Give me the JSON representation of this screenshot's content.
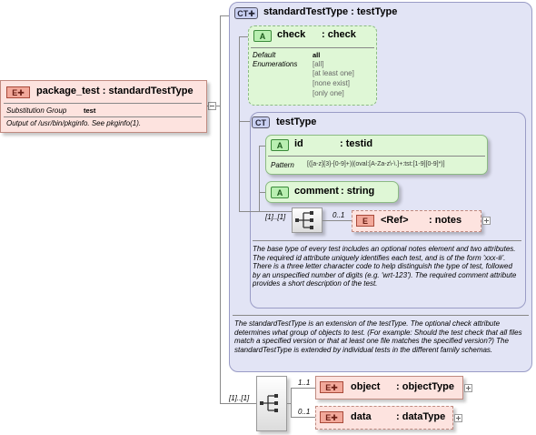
{
  "root": {
    "tag": "E",
    "title": "package_test : standardTestType",
    "subst_label": "Substitution Group",
    "subst_value": "test",
    "doc": "Output of /usr/bin/pkginfo. See pkginfo(1)."
  },
  "standard_type": {
    "tag": "CT",
    "title": "standardTestType : testType",
    "doc": "The standardTestType is an extension of the testType.  The optional check attribute determines what group of objects to test.  (For example: Should the test check that all files match a specified version or that at least one file matches the specified version?)  The standardTestType is extended by individual tests in the different family schemas."
  },
  "check_attr": {
    "tag": "A",
    "name": "check",
    "type": ": check",
    "default_label": "Default",
    "enum_label": "Enumerations",
    "default_value": "all",
    "enumerations": [
      "[all]",
      "[at least one]",
      "[none exist]",
      "[only one]"
    ]
  },
  "test_type": {
    "tag": "CT",
    "title": "testType",
    "doc": "The base type of every test includes an optional notes element and two attributes.  The required id attribute uniquely identifies each test, and is of the form 'xxx-#'.  There is a three letter character code to help distinguish the type of test, followed by an unspecified number of digits (e.g. 'wrt-123').  The required comment attribute provides a short description of the test."
  },
  "id_attr": {
    "tag": "A",
    "name": "id",
    "type": ": testid",
    "pattern_label": "Pattern",
    "pattern_value": "[([a-z]{3}-[0-9]+)|(oval:[A-Za-z\\-\\.]+:tst:[1-9][0-9]*)]"
  },
  "comment_attr": {
    "tag": "A",
    "name": "comment",
    "type": ": string"
  },
  "inner_seq": {
    "cardinality": "[1]..[1]",
    "child_cardinality": "0..1",
    "ref_tag": "E",
    "ref_name": "<Ref>",
    "ref_type": ": notes"
  },
  "outer_seq": {
    "cardinality": "[1]..[1]",
    "children": [
      {
        "cardinality": "1..1",
        "tag": "E",
        "name": "object",
        "type": ": objectType"
      },
      {
        "cardinality": "0..1",
        "tag": "E",
        "name": "data",
        "type": ": dataType"
      }
    ]
  },
  "colors": {
    "element_fill": "#fde3df",
    "element_border": "#a86a60",
    "complex_fill": "#e2e4f5",
    "complex_border": "#8a8cc0",
    "attr_fill": "#d6f5cc",
    "attr_border": "#8cba84"
  }
}
